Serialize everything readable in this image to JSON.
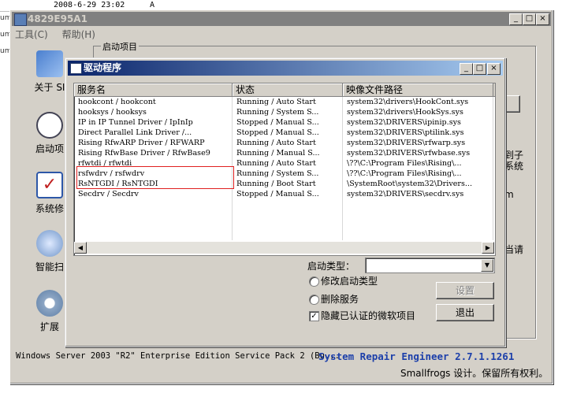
{
  "background": {
    "top_text": "2008-6-29 23:02",
    "top_letter": "A",
    "edge_labels": [
      "um",
      "um",
      "um"
    ]
  },
  "main_window": {
    "title": "4829E95A1",
    "title_buttons": [
      "_",
      "□",
      "×"
    ],
    "menu": [
      "工具(C)",
      "帮助(H)"
    ],
    "group_label": "启动项目",
    "nav": [
      {
        "label": "关于 SI",
        "icon": "about-icon"
      },
      {
        "label": "启动项",
        "icon": "clock-icon"
      },
      {
        "label": "系统修",
        "icon": "checklist-icon"
      },
      {
        "label": "智能扫",
        "icon": "magnifier-icon"
      },
      {
        "label": "扩展",
        "icon": "gear-icon"
      }
    ],
    "right_fragments": [
      "到子",
      "系统",
      "m",
      "当请"
    ],
    "status_text": "Windows Server 2003 \"R2\" Enterprise Edition Service Pack 2 (Bu...",
    "product": "System Repair Engineer 2.7.1.1261",
    "credit": "Smallfrogs 设计。保留所有权利。"
  },
  "driver_dialog": {
    "title": "驱动程序",
    "title_buttons": [
      "_",
      "□",
      "×"
    ],
    "columns": [
      "服务名",
      "状态",
      "映像文件路径"
    ],
    "rows": [
      [
        "hookcont / hookcont",
        "Running / Auto Start",
        "system32\\drivers\\HookCont.sys"
      ],
      [
        "hooksys / hooksys",
        "Running / System S...",
        "system32\\drivers\\HookSys.sys"
      ],
      [
        "IP in IP Tunnel Driver / IpInIp",
        "Stopped / Manual S...",
        "system32\\DRIVERS\\ipinip.sys"
      ],
      [
        "Direct Parallel Link Driver /...",
        "Stopped / Manual S...",
        "system32\\DRIVERS\\ptilink.sys"
      ],
      [
        "Rising RfwARP Driver / RFWARP",
        "Running / Auto Start",
        "system32\\DRIVERS\\rfwarp.sys"
      ],
      [
        "Rising RfwBase Driver / RfwBase9",
        "Running / Manual S...",
        "system32\\DRIVERS\\rfwbase.sys"
      ],
      [
        "rfwtdi / rfwtdi",
        "Running / Auto Start",
        "\\??\\C:\\Program Files\\Rising\\..."
      ],
      [
        "rsfwdrv / rsfwdrv",
        "Running / System S...",
        "\\??\\C:\\Program Files\\Rising\\..."
      ],
      [
        "RsNTGDI / RsNTGDI",
        "Running / Boot Start",
        "\\SystemRoot\\system32\\Drivers..."
      ],
      [
        "Secdrv / Secdrv",
        "Stopped / Manual S...",
        "system32\\DRIVERS\\secdrv.sys"
      ]
    ],
    "startup_type_label": "启动类型：",
    "startup_type_value": "",
    "options": {
      "modify_startup": "修改启动类型",
      "delete_service": "删除服务",
      "hide_ms": "隐藏已认证的微软项目"
    },
    "hide_ms_checked": true,
    "buttons": {
      "set": "设置",
      "exit": "退出"
    }
  }
}
